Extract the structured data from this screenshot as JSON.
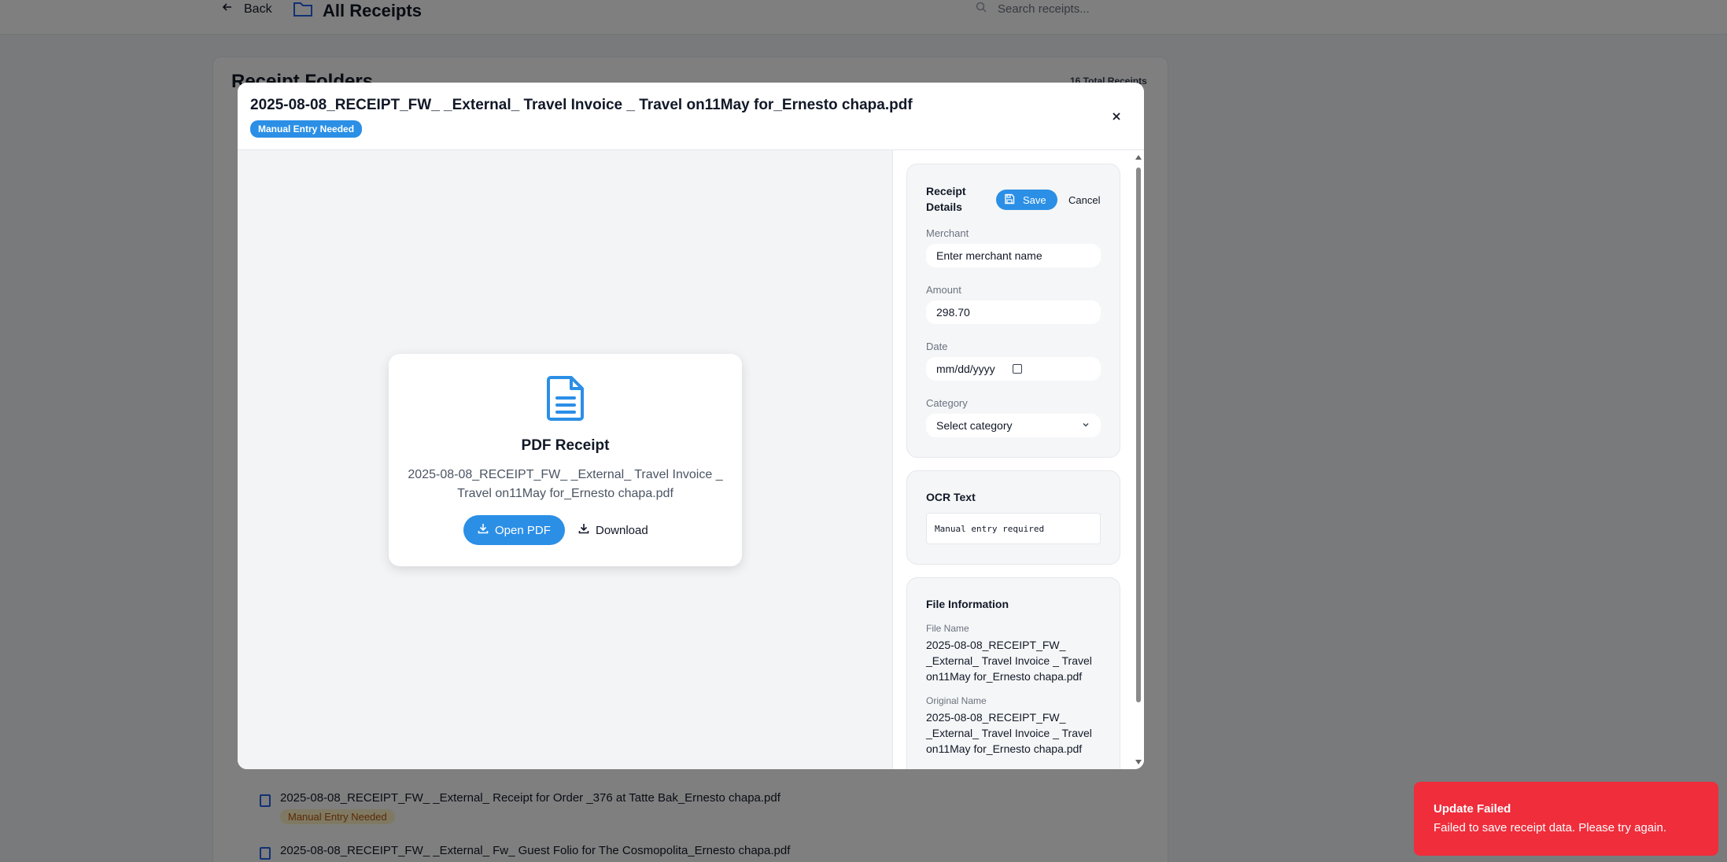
{
  "background": {
    "back_label": "Back",
    "folder_title": "All Receipts",
    "search_placeholder": "Search receipts...",
    "section_heading": "Receipt Folders",
    "total_count": "16 Total Receipts",
    "items": [
      {
        "name": "2025-08-08_RECEIPT_FW_ _External_ Receipt for Order _376 at Tatte Bak_Ernesto chapa.pdf",
        "status": "Manual Entry Needed"
      },
      {
        "name": "2025-08-08_RECEIPT_FW_ _External_ Fw_ Guest Folio for The Cosmopolita_Ernesto chapa.pdf",
        "status": ""
      }
    ]
  },
  "modal": {
    "title": "2025-08-08_RECEIPT_FW_ _External_ Travel Invoice _ Travel on11May for_Ernesto chapa.pdf",
    "badge": "Manual Entry Needed",
    "preview": {
      "heading": "PDF Receipt",
      "file_name": "2025-08-08_RECEIPT_FW_ _External_ Travel Invoice _ Travel on11May for_Ernesto chapa.pdf",
      "open_label": "Open PDF",
      "download_label": "Download"
    },
    "details": {
      "title": "Receipt Details",
      "save_label": "Save",
      "cancel_label": "Cancel",
      "merchant_label": "Merchant",
      "merchant_placeholder": "Enter merchant name",
      "amount_label": "Amount",
      "amount_value": "298.70",
      "date_label": "Date",
      "date_placeholder": "mm/dd/yyyy",
      "category_label": "Category",
      "category_value": "Select category"
    },
    "ocr": {
      "title": "OCR Text",
      "text": "Manual entry required"
    },
    "file_info": {
      "title": "File Information",
      "file_name_label": "File Name",
      "file_name": "2025-08-08_RECEIPT_FW_ _External_ Travel Invoice _ Travel on11May for_Ernesto chapa.pdf",
      "original_name_label": "Original Name",
      "original_name": "2025-08-08_RECEIPT_FW_ _External_ Travel Invoice _ Travel on11May for_Ernesto chapa.pdf"
    }
  },
  "toast": {
    "title": "Update Failed",
    "message": "Failed to save receipt data. Please try again."
  },
  "colors": {
    "accent": "#2b8fe6",
    "error": "#ef2d3b",
    "warning_badge_bg": "#fef3c7",
    "warning_badge_text": "#b45309"
  },
  "icons": [
    "arrow-left-icon",
    "folder-icon",
    "search-icon",
    "close-icon",
    "file-text-icon",
    "download-icon",
    "save-icon",
    "calendar-icon",
    "chevron-down-icon",
    "file-icon"
  ]
}
